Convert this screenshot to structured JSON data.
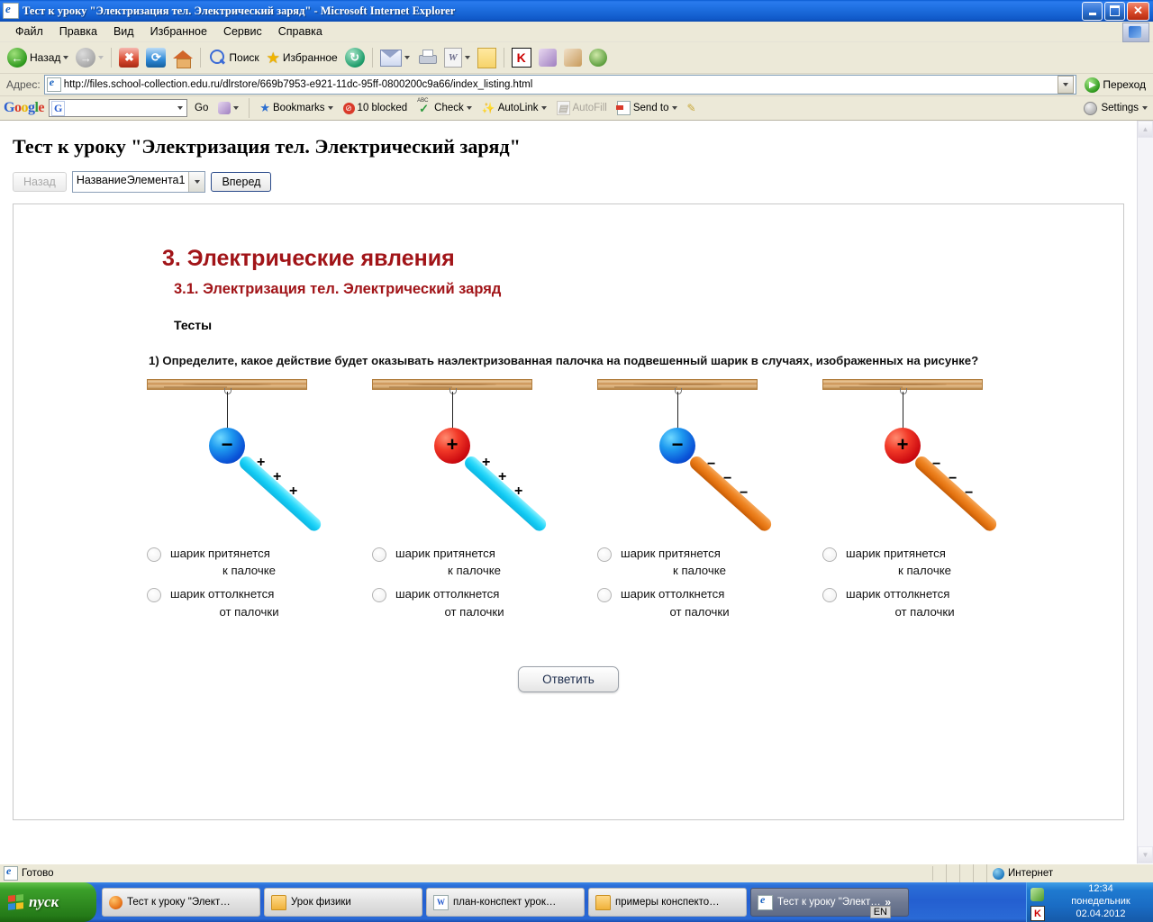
{
  "window": {
    "title": "Тест к уроку \"Электризация тел. Электрический заряд\" - Microsoft Internet Explorer",
    "icon": "ie-document-icon"
  },
  "menu": [
    "Файл",
    "Правка",
    "Вид",
    "Избранное",
    "Сервис",
    "Справка"
  ],
  "toolbar": {
    "back_label": "Назад",
    "search_label": "Поиск",
    "favorites_label": "Избранное"
  },
  "address": {
    "label": "Адрес:",
    "url": "http://files.school-collection.edu.ru/dlrstore/669b7953-e921-11dc-95ff-0800200c9a66/index_listing.html",
    "go_label": "Переход"
  },
  "google_toolbar": {
    "logo": [
      "G",
      "o",
      "o",
      "g",
      "l",
      "e"
    ],
    "search_value": "",
    "go_label": "Go",
    "bookmarks_label": "Bookmarks",
    "blocked_label": "10 blocked",
    "check_label": "Check",
    "autolink_label": "AutoLink",
    "autofill_label": "AutoFill",
    "sendto_label": "Send to",
    "settings_label": "Settings"
  },
  "page": {
    "title": "Тест к уроку \"Электризация тел. Электрический заряд\"",
    "nav": {
      "back_label": "Назад",
      "select_value": "НазваниеЭлемента1",
      "forward_label": "Вперед"
    },
    "heading_main": "3. Электрические явления",
    "heading_sub": "3.1. Электризация тел. Электрический заряд",
    "section_label": "Тесты",
    "question": "1) Определите, какое действие будет оказывать наэлектризованная палочка на подвешенный шарик в случаях, изображенных на рисунке?",
    "submit_label": "Ответить",
    "answer_options": [
      {
        "line1": "шарик притянется",
        "line2": "к палочке"
      },
      {
        "line1": "шарик оттолкнется",
        "line2": "от палочки"
      }
    ],
    "diagrams": [
      {
        "ball_charge": "−",
        "ball_color": "blue",
        "rod_color": "cyan",
        "rod_charge": "+"
      },
      {
        "ball_charge": "+",
        "ball_color": "red",
        "rod_color": "cyan",
        "rod_charge": "+"
      },
      {
        "ball_charge": "−",
        "ball_color": "blue",
        "rod_color": "orange",
        "rod_charge": "−"
      },
      {
        "ball_charge": "+",
        "ball_color": "red",
        "rod_color": "orange",
        "rod_charge": "−"
      }
    ],
    "colors": {
      "heading": "#a11418",
      "ball_negative": "#1f9bf0",
      "ball_positive": "#f23a28",
      "rod_positive": "#35dcfb",
      "rod_negative": "#ef8726",
      "wood": "#d9a76a"
    }
  },
  "status": {
    "text": "Готово",
    "zone": "Интернет"
  },
  "taskbar": {
    "start_label": "пуск",
    "buttons": [
      {
        "label": "Тест к уроку \"Элект…",
        "icon": "firefox-icon",
        "active": false
      },
      {
        "label": "Урок физики",
        "icon": "folder-icon",
        "active": false
      },
      {
        "label": "план-конспект урок…",
        "icon": "word-icon",
        "active": false
      },
      {
        "label": "примеры конспекто…",
        "icon": "folder-icon",
        "active": false
      },
      {
        "label": "Тест к уроку \"Элект…",
        "icon": "ie-icon",
        "active": true
      }
    ],
    "language": "EN",
    "overflow": "»",
    "clock": {
      "time": "12:34",
      "day": "понедельник",
      "date": "02.04.2012"
    }
  }
}
